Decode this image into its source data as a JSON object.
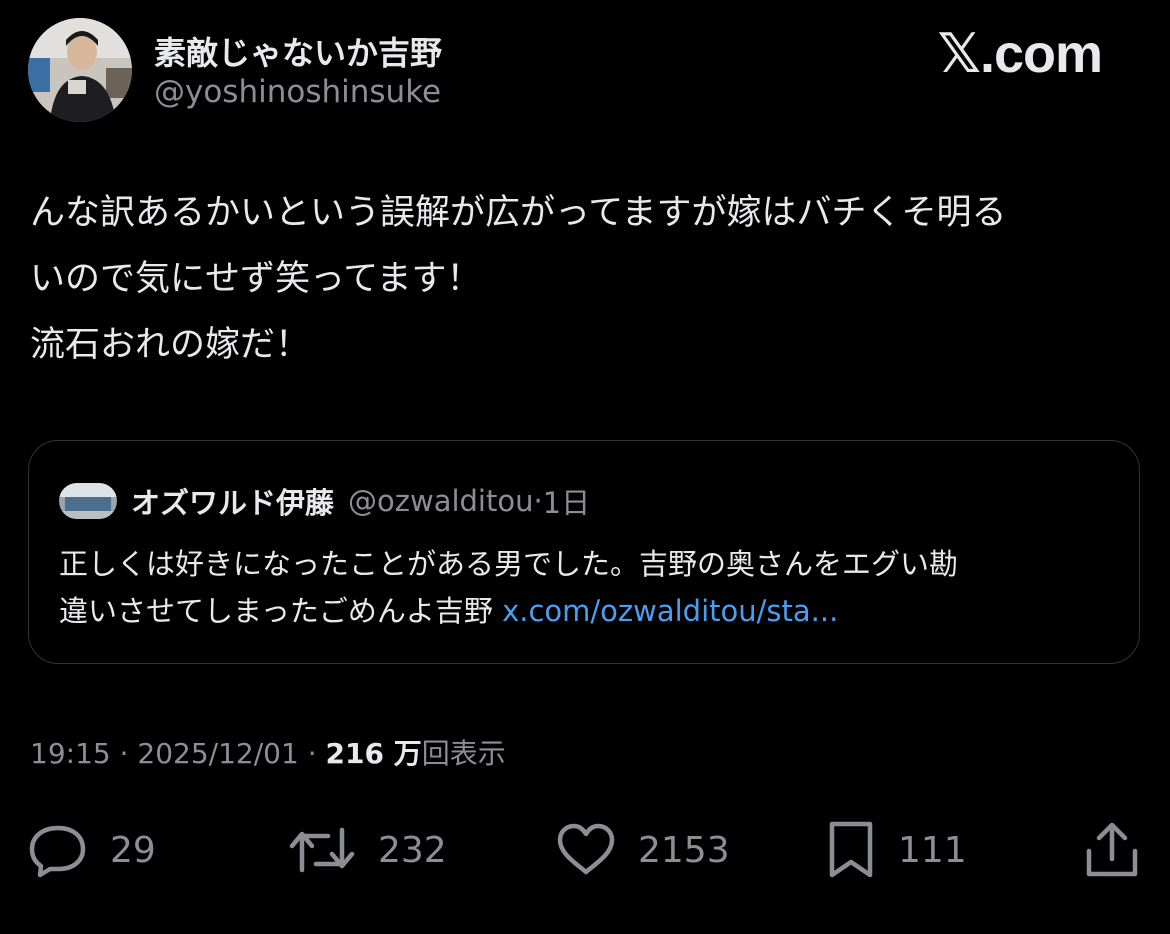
{
  "brand": {
    "text": "𝕏.com"
  },
  "author": {
    "display_name": "素敵じゃないか吉野",
    "handle": "@yoshinoshinsuke"
  },
  "tweet": {
    "lines": [
      "んな訳あるかいという誤解が広がってますが嫁はバチくそ明る",
      "いので気にせず笑ってます！",
      "流石おれの嫁だ！"
    ]
  },
  "quote": {
    "display_name": "オズワルド伊藤",
    "handle": "@ozwalditou",
    "separator": "·",
    "age": "1日",
    "line1": "正しくは好きになったことがある男でした。吉野の奥さんをエグい勘",
    "line2_text": "違いさせてしまったごめんよ吉野 ",
    "link_text": "x.com/ozwalditou/sta..."
  },
  "meta": {
    "time": "19:15",
    "separator": "·",
    "date": "2025/12/01",
    "views_count": "216 万",
    "views_label": "回表示"
  },
  "actions": {
    "replies": {
      "icon": "reply-icon",
      "count": "29"
    },
    "reposts": {
      "icon": "repost-icon",
      "count": "232"
    },
    "likes": {
      "icon": "heart-icon",
      "count": "2153"
    },
    "bookmarks": {
      "icon": "bookmark-icon",
      "count": "111"
    },
    "share": {
      "icon": "share-icon"
    }
  },
  "colors": {
    "background": "#000000",
    "text": "#e7e9ea",
    "muted": "#8b8f94",
    "link": "#4a9ef0",
    "border": "#2f3336"
  }
}
